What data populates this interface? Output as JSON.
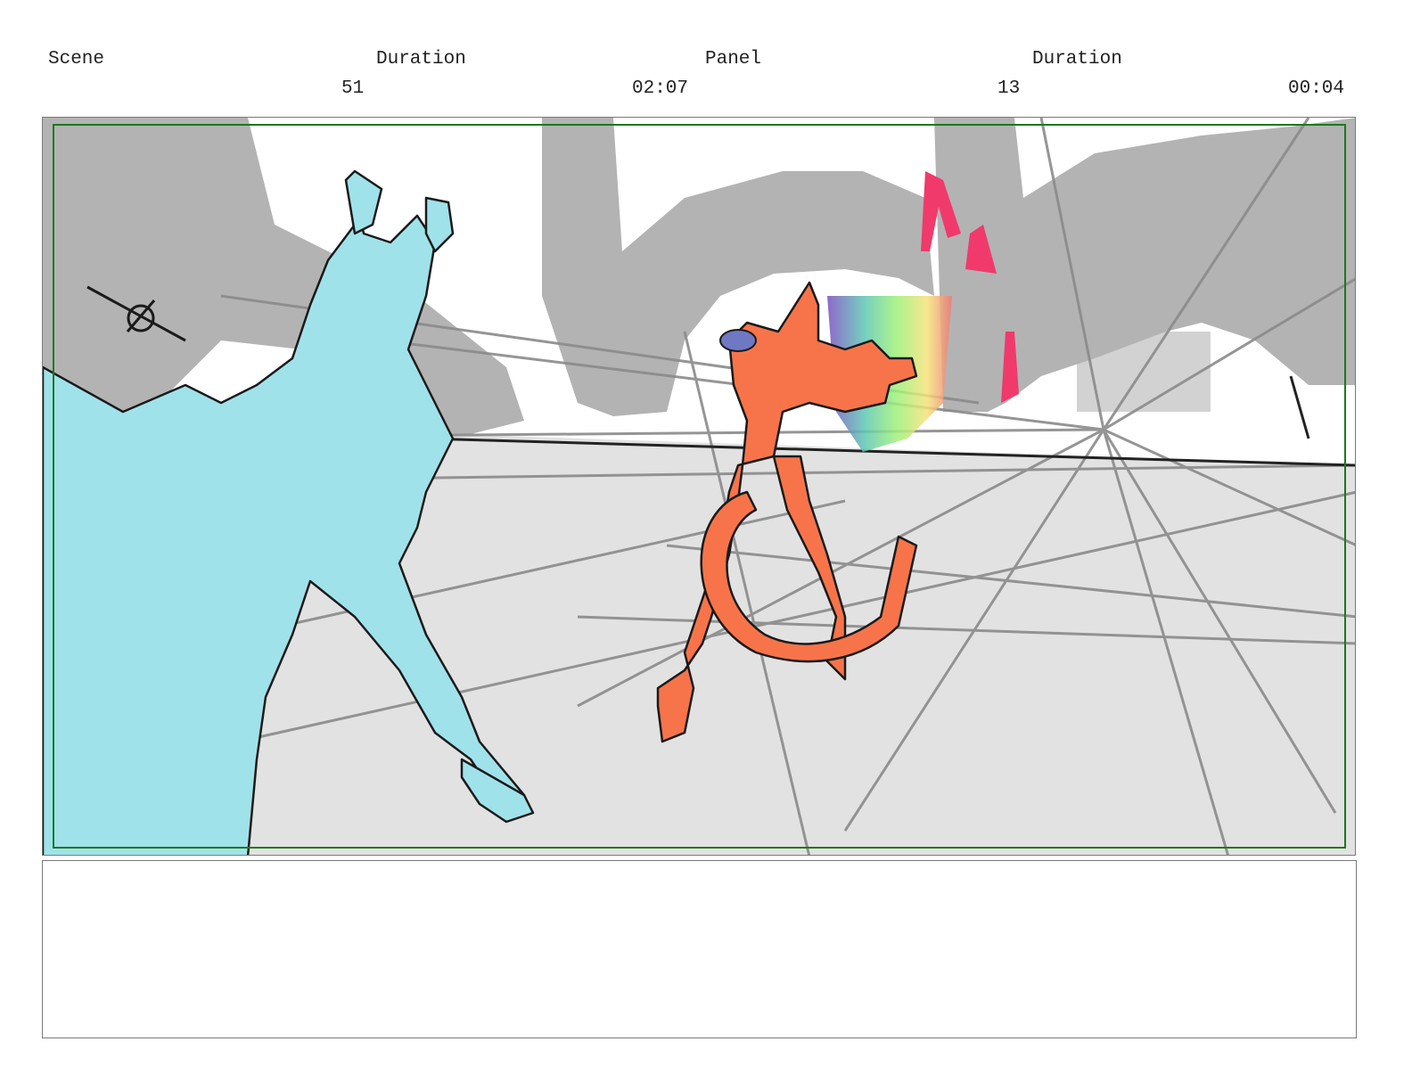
{
  "header": {
    "scene_label": "Scene",
    "scene_duration_label": "Duration",
    "panel_label": "Panel",
    "panel_duration_label": "Duration",
    "scene_value": "51",
    "scene_duration_value": "02:07",
    "panel_value": "13",
    "panel_duration_value": "00:04"
  },
  "colors": {
    "left_character": "#a0e2ea",
    "right_character": "#f7744a",
    "effect_pink": "#f03a6b",
    "safe_area": "#1a7a1a",
    "floor": "#e2e2e2",
    "structures": "#a8a8a8"
  },
  "notes": {
    "text": ""
  }
}
